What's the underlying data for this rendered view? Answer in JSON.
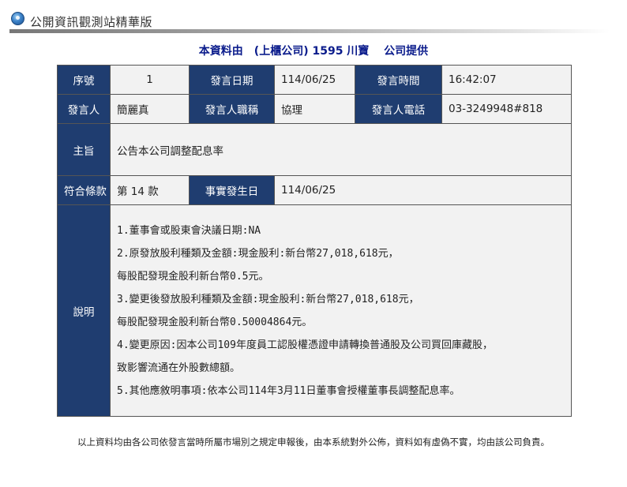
{
  "header": {
    "icon": "globe-icon",
    "title": "公開資訊觀測站精華版"
  },
  "provider_line": "本資料由　(上櫃公司) 1595 川寶　 公司提供",
  "table": {
    "seq_label": "序號",
    "seq_value": "1",
    "date_label": "發言日期",
    "date_value": "114/06/25",
    "time_label": "發言時間",
    "time_value": "16:42:07",
    "speaker_label": "發言人",
    "speaker_value": "簡麗真",
    "title_label": "發言人職稱",
    "title_value": "協理",
    "phone_label": "發言人電話",
    "phone_value": "03-3249948#818",
    "subject_label": "主旨",
    "subject_value": "公告本公司調整配息率",
    "clause_label": "符合條款",
    "clause_value": "第 14 款",
    "event_date_label": "事實發生日",
    "event_date_value": "114/06/25",
    "desc_label": "說明",
    "desc_lines": [
      "1.董事會或股東會決議日期:NA",
      "2.原發放股利種類及金額:現金股利:新台幣27,018,618元，",
      "每股配發現金股利新台幣0.5元。",
      "3.變更後發放股利種類及金額:現金股利:新台幣27,018,618元，",
      "每股配發現金股利新台幣0.50004864元。",
      "4.變更原因:因本公司109年度員工認股權憑證申請轉換普通股及公司買回庫藏股，",
      "致影響流通在外股數總額。",
      "5.其他應敘明事項:依本公司114年3月11日董事會授權董事長調整配息率。"
    ]
  },
  "footer": "以上資料均由各公司依發言當時所屬市場別之規定申報後，由本系統對外公佈，資料如有虛偽不實，均由該公司負責。",
  "colors": {
    "label_bg": "#1f3d70",
    "value_bg": "#f2f2f2",
    "provider_text": "#0b1c8c"
  }
}
